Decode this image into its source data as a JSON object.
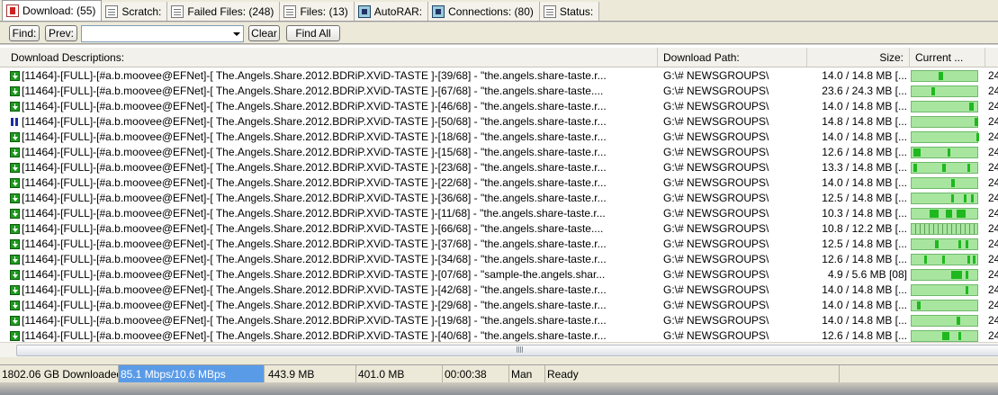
{
  "tabs": [
    {
      "label": "Download: (55)",
      "icon": "download-list-icon",
      "active": true
    },
    {
      "label": "Scratch:",
      "icon": "document-icon",
      "active": false
    },
    {
      "label": "Failed Files: (248)",
      "icon": "document-icon",
      "active": false
    },
    {
      "label": "Files: (13)",
      "icon": "document-icon",
      "active": false
    },
    {
      "label": "AutoRAR:",
      "icon": "network-icon",
      "active": false
    },
    {
      "label": "Connections: (80)",
      "icon": "network-icon",
      "active": false
    },
    {
      "label": "Status:",
      "icon": "document-icon",
      "active": false
    }
  ],
  "findbar": {
    "find_label": "Find:",
    "prev_label": "Prev:",
    "search_value": "",
    "clear_label": "Clear",
    "find_all_label": "Find All"
  },
  "table": {
    "columns": {
      "description": "Download Descriptions:",
      "path": "Download Path:",
      "size": "Size:",
      "current": "Current ..."
    },
    "rows": [
      {
        "status": "downloading",
        "desc": "[11464]-[FULL]-[#a.b.moovee@EFNet]-[ The.Angels.Share.2012.BDRiP.XViD-TASTE ]-[39/68] - \"the.angels.share-taste.r...",
        "path": "G:\\# NEWSGROUPS\\",
        "size": "14.0 / 14.8 MB [...",
        "extra": "24"
      },
      {
        "status": "downloading",
        "desc": "[11464]-[FULL]-[#a.b.moovee@EFNet]-[ The.Angels.Share.2012.BDRiP.XViD-TASTE ]-[67/68] - \"the.angels.share-taste....",
        "path": "G:\\# NEWSGROUPS\\",
        "size": "23.6 / 24.3 MB [...",
        "extra": "24"
      },
      {
        "status": "downloading",
        "desc": "[11464]-[FULL]-[#a.b.moovee@EFNet]-[ The.Angels.Share.2012.BDRiP.XViD-TASTE ]-[46/68] - \"the.angels.share-taste.r...",
        "path": "G:\\# NEWSGROUPS\\",
        "size": "14.0 / 14.8 MB [...",
        "extra": "24"
      },
      {
        "status": "paused",
        "desc": "[11464]-[FULL]-[#a.b.moovee@EFNet]-[ The.Angels.Share.2012.BDRiP.XViD-TASTE ]-[50/68] - \"the.angels.share-taste.r...",
        "path": "G:\\# NEWSGROUPS\\",
        "size": "14.8 / 14.8 MB [...",
        "extra": "24"
      },
      {
        "status": "downloading",
        "desc": "[11464]-[FULL]-[#a.b.moovee@EFNet]-[ The.Angels.Share.2012.BDRiP.XViD-TASTE ]-[18/68] - \"the.angels.share-taste.r...",
        "path": "G:\\# NEWSGROUPS\\",
        "size": "14.0 / 14.8 MB [...",
        "extra": "24"
      },
      {
        "status": "downloading",
        "desc": "[11464]-[FULL]-[#a.b.moovee@EFNet]-[ The.Angels.Share.2012.BDRiP.XViD-TASTE ]-[15/68] - \"the.angels.share-taste.r...",
        "path": "G:\\# NEWSGROUPS\\",
        "size": "12.6 / 14.8 MB [...",
        "extra": "24"
      },
      {
        "status": "downloading",
        "desc": "[11464]-[FULL]-[#a.b.moovee@EFNet]-[ The.Angels.Share.2012.BDRiP.XViD-TASTE ]-[23/68] - \"the.angels.share-taste.r...",
        "path": "G:\\# NEWSGROUPS\\",
        "size": "13.3 / 14.8 MB [...",
        "extra": "24"
      },
      {
        "status": "downloading",
        "desc": "[11464]-[FULL]-[#a.b.moovee@EFNet]-[ The.Angels.Share.2012.BDRiP.XViD-TASTE ]-[22/68] - \"the.angels.share-taste.r...",
        "path": "G:\\# NEWSGROUPS\\",
        "size": "14.0 / 14.8 MB [...",
        "extra": "24"
      },
      {
        "status": "downloading",
        "desc": "[11464]-[FULL]-[#a.b.moovee@EFNet]-[ The.Angels.Share.2012.BDRiP.XViD-TASTE ]-[36/68] - \"the.angels.share-taste.r...",
        "path": "G:\\# NEWSGROUPS\\",
        "size": "12.5 / 14.8 MB [...",
        "extra": "24"
      },
      {
        "status": "downloading",
        "desc": "[11464]-[FULL]-[#a.b.moovee@EFNet]-[ The.Angels.Share.2012.BDRiP.XViD-TASTE ]-[11/68] - \"the.angels.share-taste.r...",
        "path": "G:\\# NEWSGROUPS\\",
        "size": "10.3 / 14.8 MB [...",
        "extra": "24"
      },
      {
        "status": "downloading",
        "desc": "[11464]-[FULL]-[#a.b.moovee@EFNet]-[ The.Angels.Share.2012.BDRiP.XViD-TASTE ]-[66/68] - \"the.angels.share-taste....",
        "path": "G:\\# NEWSGROUPS\\",
        "size": "10.8 / 12.2 MB [...",
        "extra": "24"
      },
      {
        "status": "downloading",
        "desc": "[11464]-[FULL]-[#a.b.moovee@EFNet]-[ The.Angels.Share.2012.BDRiP.XViD-TASTE ]-[37/68] - \"the.angels.share-taste.r...",
        "path": "G:\\# NEWSGROUPS\\",
        "size": "12.5 / 14.8 MB [...",
        "extra": "24"
      },
      {
        "status": "downloading",
        "desc": "[11464]-[FULL]-[#a.b.moovee@EFNet]-[ The.Angels.Share.2012.BDRiP.XViD-TASTE ]-[34/68] - \"the.angels.share-taste.r...",
        "path": "G:\\# NEWSGROUPS\\",
        "size": "12.6 / 14.8 MB [...",
        "extra": "24"
      },
      {
        "status": "downloading",
        "desc": "[11464]-[FULL]-[#a.b.moovee@EFNet]-[ The.Angels.Share.2012.BDRiP.XViD-TASTE ]-[07/68] - \"sample-the.angels.shar...",
        "path": "G:\\# NEWSGROUPS\\",
        "size": "4.9 / 5.6 MB [08]",
        "extra": "24"
      },
      {
        "status": "downloading",
        "desc": "[11464]-[FULL]-[#a.b.moovee@EFNet]-[ The.Angels.Share.2012.BDRiP.XViD-TASTE ]-[42/68] - \"the.angels.share-taste.r...",
        "path": "G:\\# NEWSGROUPS\\",
        "size": "14.0 / 14.8 MB [...",
        "extra": "24"
      },
      {
        "status": "downloading",
        "desc": "[11464]-[FULL]-[#a.b.moovee@EFNet]-[ The.Angels.Share.2012.BDRiP.XViD-TASTE ]-[29/68] - \"the.angels.share-taste.r...",
        "path": "G:\\# NEWSGROUPS\\",
        "size": "14.0 / 14.8 MB [...",
        "extra": "24"
      },
      {
        "status": "downloading",
        "desc": "[11464]-[FULL]-[#a.b.moovee@EFNet]-[ The.Angels.Share.2012.BDRiP.XViD-TASTE ]-[19/68] - \"the.angels.share-taste.r...",
        "path": "G:\\# NEWSGROUPS\\",
        "size": "14.0 / 14.8 MB [...",
        "extra": "24"
      },
      {
        "status": "downloading",
        "desc": "[11464]-[FULL]-[#a.b.moovee@EFNet]-[ The.Angels.Share.2012.BDRiP.XViD-TASTE ]-[40/68] - \"the.angels.share-taste.r...",
        "path": "G:\\# NEWSGROUPS\\",
        "size": "12.6 / 14.8 MB [...",
        "extra": "24"
      }
    ]
  },
  "statusbar": {
    "downloaded": "1802.06 GB Downloaded",
    "speed": "85.1 Mbps/10.6 MBps",
    "size1": "443.9 MB",
    "size2": "401.0 MB",
    "time": "00:00:38",
    "mode": "Man",
    "state": "Ready"
  },
  "colors": {
    "progress_bg": "#a8e6a0",
    "progress_segment": "#1fb81f",
    "speed_highlight": "#5a9be8",
    "download_icon": "#1f9a1f",
    "pause_icon": "#1a2fa0"
  }
}
